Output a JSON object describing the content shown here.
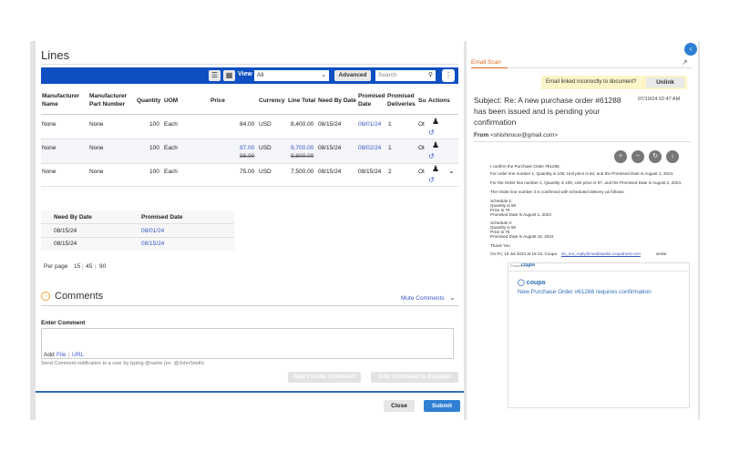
{
  "lines": {
    "title": "Lines",
    "toolbar": {
      "view_label": "View",
      "view_value": "All",
      "advanced_label": "Advanced",
      "search_placeholder": "Search"
    },
    "headers": [
      "Manufacturer Name",
      "Manufacturer Part Number",
      "Quantity",
      "UOM",
      "Price",
      "Currency",
      "Line Total",
      "Need By Date",
      "Promised Date",
      "Promised Deliveries",
      "Su",
      "Actions"
    ],
    "rows": [
      {
        "mfr_name": "None",
        "mfr_part": "None",
        "quantity": "100",
        "uom": "Each",
        "price": "84.00",
        "price_old": "",
        "currency": "USD",
        "line_total": "8,400.00",
        "line_total_old": "",
        "need_by": "08/15/24",
        "promised": "08/01/24",
        "deliveries": "1",
        "su": "Ot"
      },
      {
        "mfr_name": "None",
        "mfr_part": "None",
        "quantity": "100",
        "uom": "Each",
        "price": "97.00",
        "price_old": "98.00",
        "currency": "USD",
        "line_total": "9,700.00",
        "line_total_old": "9,800.00",
        "need_by": "08/15/24",
        "promised": "08/02/24",
        "deliveries": "1",
        "su": "Ot"
      },
      {
        "mfr_name": "None",
        "mfr_part": "None",
        "quantity": "100",
        "uom": "Each",
        "price": "75.00",
        "price_old": "",
        "currency": "USD",
        "line_total": "7,500.00",
        "line_total_old": "",
        "need_by": "08/15/24",
        "promised": "08/15/24",
        "deliveries": "2",
        "su": "Ot"
      }
    ],
    "schedule": {
      "headers": [
        "Need By Date",
        "Promised Date"
      ],
      "rows": [
        [
          "08/15/24",
          "08/01/24"
        ],
        [
          "08/15/24",
          "08/15/24"
        ]
      ]
    },
    "per_page_label": "Per page",
    "per_page_options": [
      "15",
      "45",
      "90"
    ]
  },
  "comments": {
    "title": "Comments",
    "mute_label": "Mute Comments",
    "enter_label": "Enter Comment",
    "add_label": "Add",
    "file_label": "File",
    "url_label": "URL",
    "hint": "Send Comment notification to a user by typing @name (ex. @JohnSmith)",
    "private_btn": "Add Private Comment",
    "supplier_btn": "Add Comment to Supplier"
  },
  "footer": {
    "close_label": "Close",
    "submit_label": "Submit"
  },
  "email": {
    "tab_label": "Email Scan",
    "warning_text": "Email linked incorrectly to document?",
    "unlink_label": "Unlink",
    "subject": "Subject: Re: A new purchase order #61288 has been issued and is pending your confirmation",
    "date": "07/19/24 02:47 AM",
    "from_label": "From",
    "from_value": "<shishinxuv@gmail.com>",
    "body_lines": [
      "I confirm the Purchase Order #61288.",
      "For order line number 1, Quantity is 100, Unit price is 84, and the Promised Date is August 1, 2024.",
      "For the Order line number 2, Quantity is 100, Unit price is 97, and the Promised Date is August 2, 2024.",
      "The Order line number 3 is confirmed with scheduled delivery as follows:",
      "Schedule 1:",
      "Quantity is 50",
      "Price is 75",
      "Promised Date is August 1, 2024",
      "Schedule 2:",
      "Quantity is 50",
      "Price is 75",
      "Promised Date is August 15, 2024",
      "Thank You",
      "On Fri, 19 Jul 2024 at 15:13, Coupa"
    ],
    "reply_link": "do_not_reply@mediasailor.coupahost.com",
    "wrote": "wrote:",
    "powered_by": "Powered by",
    "card_logo": "coupa",
    "card_link": "New Purchase Order #61288 requires confirmation"
  }
}
